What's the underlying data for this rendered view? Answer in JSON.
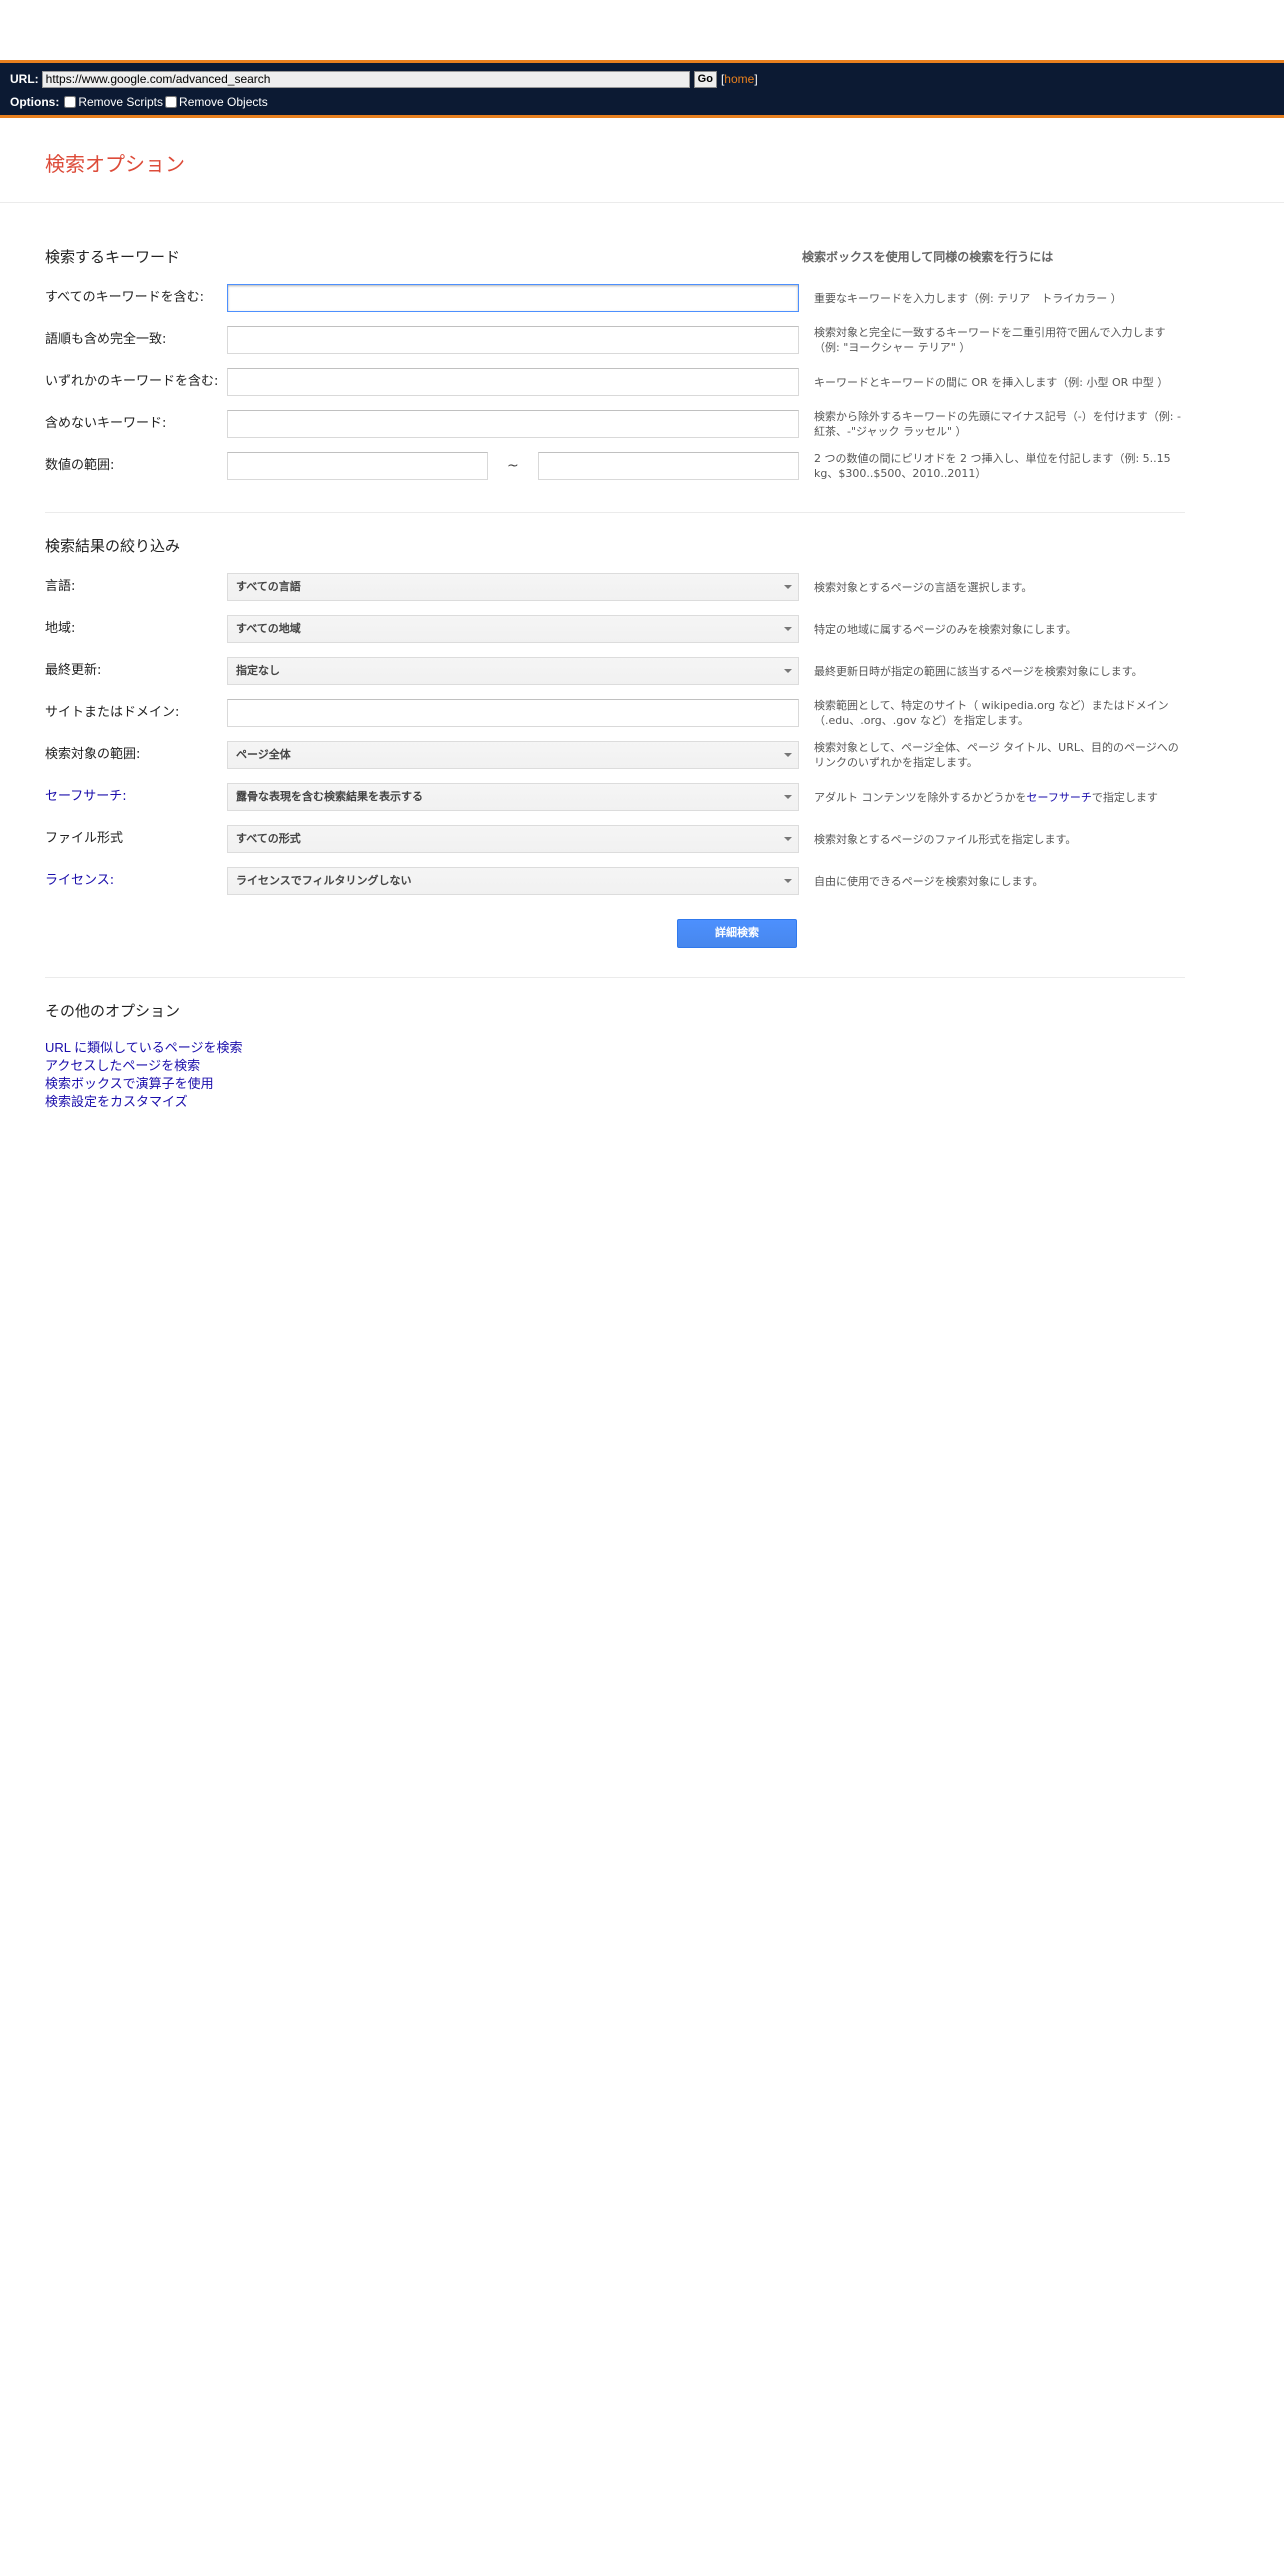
{
  "proxy": {
    "url_label": "URL:",
    "url_value": "https://www.google.com/advanced_search",
    "go_label": "Go",
    "bracket_open": "[",
    "home_label": "home",
    "bracket_close": "]",
    "options_label": "Options:",
    "remove_scripts_label": "Remove Scripts",
    "remove_objects_label": "Remove Objects"
  },
  "page_title": "検索オプション",
  "keywords": {
    "title": "検索するキーワード",
    "help_header": "検索ボックスを使用して同様の検索を行うには",
    "all_words": {
      "label": "すべてのキーワードを含む:",
      "help": "重要なキーワードを入力します（例: テリア　トライカラー ）"
    },
    "exact_phrase": {
      "label": "語順も含め完全一致:",
      "help": "検索対象と完全に一致するキーワードを二重引用符で囲んで入力します（例: \"ヨークシャー テリア\" ）"
    },
    "any_words": {
      "label": "いずれかのキーワードを含む:",
      "help": "キーワードとキーワードの間に OR を挿入します（例: 小型 OR 中型 ）"
    },
    "none_words": {
      "label": "含めないキーワード:",
      "help": "検索から除外するキーワードの先頭にマイナス記号（-）を付けます（例: -紅茶、-\"ジャック ラッセル\" ）"
    },
    "range": {
      "label": "数値の範囲:",
      "separator": "~",
      "help": "2 つの数値の間にピリオドを 2 つ挿入し、単位を付記します（例: 5..15 kg、$300..$500、2010..2011）"
    }
  },
  "narrow": {
    "title": "検索結果の絞り込み",
    "language": {
      "label": "言語:",
      "value": "すべての言語",
      "help": "検索対象とするページの言語を選択します。"
    },
    "region": {
      "label": "地域:",
      "value": "すべての地域",
      "help": "特定の地域に属するページのみを検索対象にします。"
    },
    "last_update": {
      "label": "最終更新:",
      "value": "指定なし",
      "help": "最終更新日時が指定の範囲に該当するページを検索対象にします。"
    },
    "site": {
      "label": "サイトまたはドメイン:",
      "help": "検索範囲として、特定のサイト（ wikipedia.org など）またはドメイン（.edu、.org、.gov など）を指定します。"
    },
    "terms_appearing": {
      "label": "検索対象の範囲:",
      "value": "ページ全体",
      "help": "検索対象として、ページ全体、ページ タイトル、URL、目的のページへのリンクのいずれかを指定します。"
    },
    "safesearch": {
      "label": "セーフサーチ:",
      "value": "露骨な表現を含む検索結果を表示する",
      "help_pre": "アダルト コンテンツを除外するかどうかを",
      "help_link": "セーフサーチ",
      "help_post": "で指定します"
    },
    "file_type": {
      "label": "ファイル形式",
      "value": "すべての形式",
      "help": "検索対象とするページのファイル形式を指定します。"
    },
    "license": {
      "label": "ライセンス:",
      "value": "ライセンスでフィルタリングしない",
      "help": "自由に使用できるページを検索対象にします。"
    }
  },
  "submit_label": "詳細検索",
  "other": {
    "title": "その他のオプション",
    "links": [
      "URL に類似しているページを検索",
      "アクセスしたページを検索",
      "検索ボックスで演算子を使用",
      "検索設定をカスタマイズ"
    ]
  }
}
